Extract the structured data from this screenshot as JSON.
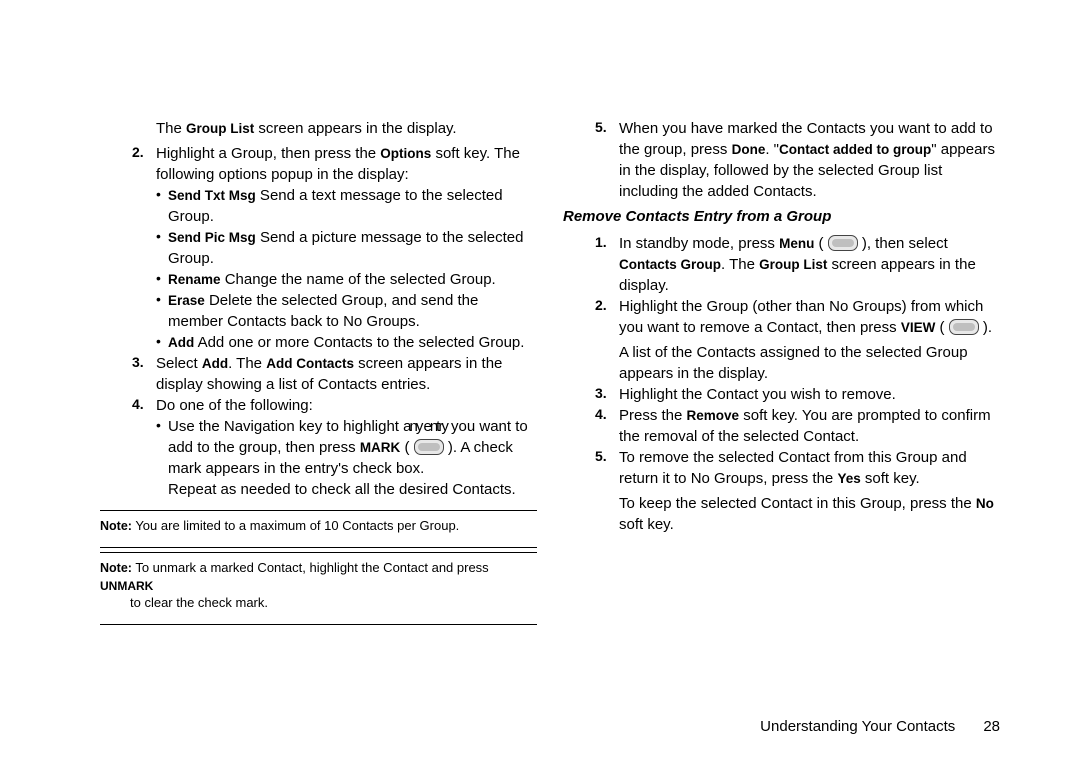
{
  "left": {
    "l1a": "The ",
    "l1b": "Group List",
    "l1c": " screen appears in the display.",
    "n2": "2.",
    "l2a": "Highlight a Group, then press the ",
    "l2b": "Options",
    "l2c": " soft key. The following options popup in the display:",
    "b1a": "Send Txt Msg",
    "b1b": "   Send a text message to the selected Group.",
    "b2a": "Send Pic Msg",
    "b2b": "   Send a picture message to the selected Group.",
    "b3a": "Rename",
    "b3b": "   Change the name of the selected Group.",
    "b4a": "Erase",
    "b4b": "   Delete the selected Group, and send the member Contacts back to No Groups.",
    "b5a": "Add",
    "b5b": "   Add one or more Contacts to the selected Group.",
    "n3": "3.",
    "l3a": "Select ",
    "l3b": "Add",
    "l3c": ". The ",
    "l3d": "Add Contacts",
    "l3e": " screen appears in the display showing a list of Contacts entries.",
    "n4": "4.",
    "l4": "Do one of the following:",
    "s4a": "Use the Navigation key to highlight ",
    "s4a2": "any entry",
    "s4a3": " you want to add to the group, then press ",
    "s4mark": "MARK",
    "s4b": " ( ",
    "s4c": " ). A check mark appears in the entry's check box.",
    "s4repeat": "Repeat as needed to check all the desired Contacts.",
    "note1label": "Note:",
    "note1": " You are limited to a maximum of 10 Contacts per Group.",
    "note2label": "Note:",
    "note2a": " To unmark a marked Contact, highlight the Contact and press ",
    "note2b": "UNMARK",
    "note2c": " to clear the check mark."
  },
  "right": {
    "n5": "5.",
    "r5a": "When you have marked the Contacts you want to add to the group, press ",
    "r5b": "Done",
    "r5c": ". \"",
    "r5d": "Contact added to group",
    "r5e": "\" appears in the display, followed by the selected Group list including the added Contacts.",
    "sectionTitle": "Remove Contacts Entry from a Group",
    "rn1": "1.",
    "r1a": "In standby mode, press ",
    "r1b": "Menu",
    "r1c": " ( ",
    "r1d": " ), then select ",
    "r1e": "Contacts Group",
    "r1f": ". The ",
    "r1g": "Group List",
    "r1h": " screen appears in the display.",
    "rn2": "2.",
    "r2a": "Highlight the Group (other than No Groups) from which you want to remove a Contact, then press ",
    "r2b": "VIEW",
    "r2c": " ( ",
    "r2d": " ).",
    "r2e": "A list of the Contacts assigned to the selected Group appears in the display.",
    "rn3": "3.",
    "r3": "Highlight the Contact you wish to remove.",
    "rn4": "4.",
    "r4a": "Press the ",
    "r4b": "Remove",
    "r4c": " soft key. You are prompted to confirm the removal of the selected Contact.",
    "rn5b": "5.",
    "r5ba": "To remove the selected Contact from this Group and return it to No Groups, press the ",
    "r5bb": "Yes",
    "r5bc": " soft key.",
    "r5ca": "To keep the selected Contact in this Group, press the ",
    "r5cb": "No",
    "r5cc": " soft key."
  },
  "footer": {
    "section": "Understanding Your Contacts",
    "page": "28"
  }
}
